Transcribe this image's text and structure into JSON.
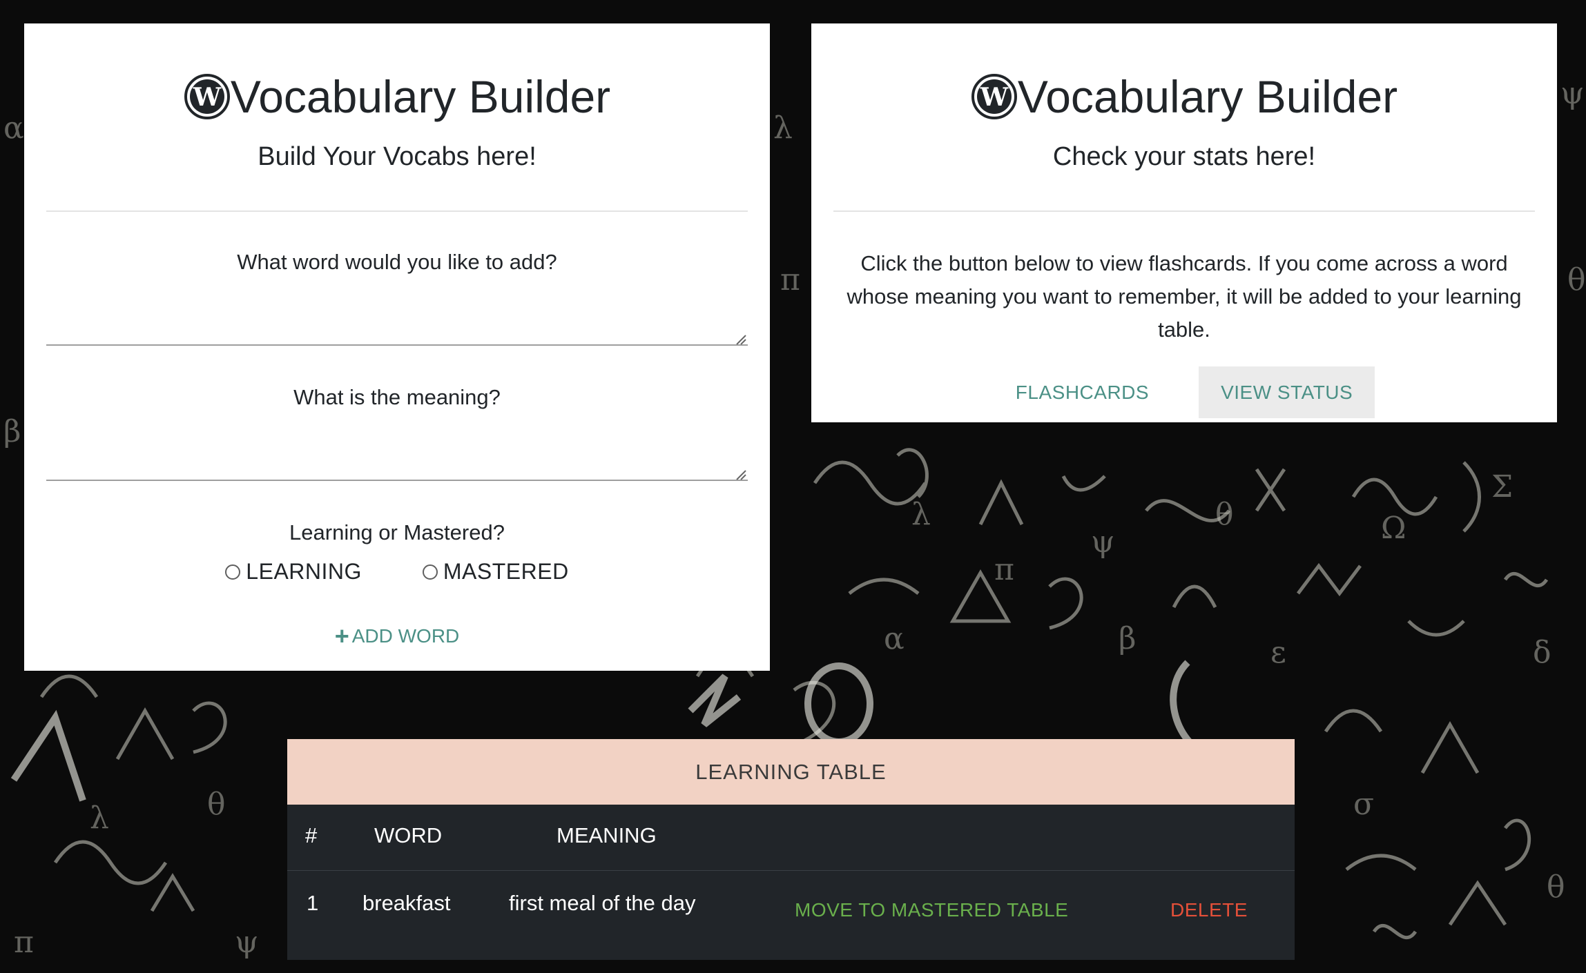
{
  "app": {
    "title": "Vocabulary Builder",
    "logo_icon": "wordpress-icon"
  },
  "add_card": {
    "subtitle": "Build Your Vocabs here!",
    "word_label": "What word would you like to add?",
    "word_value": "",
    "meaning_label": "What is the meaning?",
    "meaning_value": "",
    "status_label": "Learning or Mastered?",
    "options": [
      "LEARNING",
      "MASTERED"
    ],
    "selected_option": null,
    "add_button": "ADD WORD",
    "add_icon": "plus-icon"
  },
  "stats_card": {
    "subtitle": "Check your stats here!",
    "description": "Click the button below to view flashcards. If you come across a word whose meaning you want to remember, it will be added to your learning table.",
    "buttons": [
      "FLASHCARDS",
      "VIEW STATUS"
    ],
    "active_button": "VIEW STATUS"
  },
  "learning_table": {
    "title": "LEARNING TABLE",
    "columns": [
      "#",
      "WORD",
      "MEANING"
    ],
    "rows": [
      {
        "index": "1",
        "word": "breakfast",
        "meaning": "first meal of the day",
        "move_action": "MOVE TO MASTERED TABLE",
        "delete_action": "DELETE"
      }
    ]
  },
  "colors": {
    "accent": "#4b9086",
    "table_header_bg": "#f2d2c4",
    "table_bg": "#212529",
    "move_color": "#6ab04c",
    "delete_color": "#e55039"
  }
}
